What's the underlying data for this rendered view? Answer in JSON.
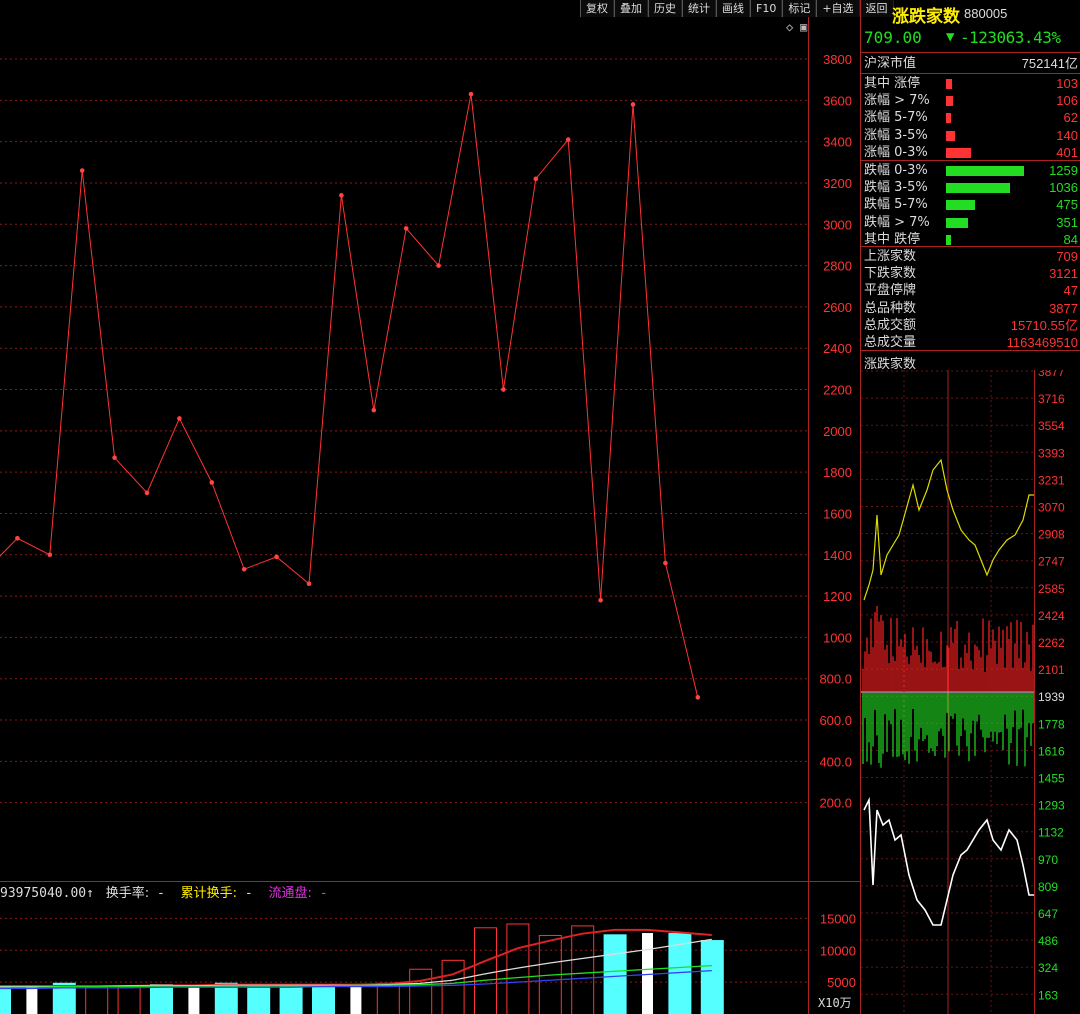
{
  "toolbar": [
    "复权",
    "叠加",
    "历史",
    "统计",
    "画线",
    "F10",
    "标记",
    "+自选",
    "返回"
  ],
  "header": {
    "name": "涨跌家数",
    "code": "880005",
    "price": "709.00",
    "change": "-123063.43%"
  },
  "market": {
    "label": "沪深市值",
    "value": "752141亿"
  },
  "stats_up": [
    {
      "label": "其中 涨停",
      "value": "103",
      "bar": 103
    },
    {
      "label": "涨幅 > 7%",
      "value": "106",
      "bar": 106
    },
    {
      "label": "涨幅 5-7%",
      "value": "62",
      "bar": 62
    },
    {
      "label": "涨幅 3-5%",
      "value": "140",
      "bar": 140
    },
    {
      "label": "涨幅 0-3%",
      "value": "401",
      "bar": 401
    }
  ],
  "stats_down": [
    {
      "label": "跌幅 0-3%",
      "value": "1259",
      "bar": 1259
    },
    {
      "label": "跌幅 3-5%",
      "value": "1036",
      "bar": 1036
    },
    {
      "label": "跌幅 5-7%",
      "value": "475",
      "bar": 475
    },
    {
      "label": "跌幅 > 7%",
      "value": "351",
      "bar": 351
    },
    {
      "label": "其中 跌停",
      "value": "84",
      "bar": 84
    }
  ],
  "summary": [
    {
      "label": "上涨家数",
      "value": "709"
    },
    {
      "label": "下跌家数",
      "value": "3121"
    },
    {
      "label": "平盘停牌",
      "value": "47"
    },
    {
      "label": "总品种数",
      "value": "3877"
    },
    {
      "label": "总成交额",
      "value": "15710.55亿"
    },
    {
      "label": "总成交量",
      "value": "1163469510"
    }
  ],
  "mini_title": "涨跌家数",
  "mini_axis": [
    "3877",
    "3716",
    "3554",
    "3393",
    "3231",
    "3070",
    "2908",
    "2747",
    "2585",
    "2424",
    "2262",
    "2101",
    "1939",
    "1778",
    "1616",
    "1455",
    "1293",
    "1132",
    "970",
    "809",
    "647",
    "486",
    "324",
    "163"
  ],
  "volume_panel": {
    "volume_text": "93975040.00↑",
    "turnover_label": "换手率:",
    "turnover_value": "-",
    "cum_turnover_label": "累计换手:",
    "cum_turnover_value": "-",
    "float_label": "流通盘:",
    "float_value": "-",
    "unit": "X10万",
    "ticks": [
      "15000",
      "10000",
      "5000"
    ]
  },
  "chart_data": {
    "type": "line",
    "y_ticks": [
      "3800",
      "3600",
      "3400",
      "3200",
      "3000",
      "2800",
      "2600",
      "2400",
      "2200",
      "2000",
      "1800",
      "1600",
      "1400",
      "1200",
      "1000",
      "800.0",
      "600.0",
      "400.0",
      "200.0"
    ],
    "ylim": [
      0,
      3900
    ],
    "series": [
      {
        "values": [
          1320,
          1480,
          1400,
          3260,
          1870,
          1700,
          2060,
          1750,
          1330,
          1390,
          1260,
          3140,
          2100,
          2980,
          2800,
          3630,
          2200,
          3220,
          3410,
          1180,
          3580,
          1360,
          710
        ]
      }
    ],
    "volume": {
      "ylim": [
        0,
        17000
      ],
      "bars": [
        {
          "v": 4300,
          "c": "cyan"
        },
        {
          "v": 4300,
          "c": "white"
        },
        {
          "v": 4900,
          "c": "cyan"
        },
        {
          "v": 4300,
          "c": "red"
        },
        {
          "v": 4300,
          "c": "red"
        },
        {
          "v": 4700,
          "c": "cyan"
        },
        {
          "v": 4500,
          "c": "white"
        },
        {
          "v": 4900,
          "c": "cyan"
        },
        {
          "v": 4300,
          "c": "cyan"
        },
        {
          "v": 4300,
          "c": "cyan"
        },
        {
          "v": 4300,
          "c": "cyan"
        },
        {
          "v": 4300,
          "c": "white"
        },
        {
          "v": 4900,
          "c": "red"
        },
        {
          "v": 7100,
          "c": "red"
        },
        {
          "v": 8500,
          "c": "red"
        },
        {
          "v": 13600,
          "c": "red"
        },
        {
          "v": 14200,
          "c": "red"
        },
        {
          "v": 12400,
          "c": "red"
        },
        {
          "v": 13900,
          "c": "red"
        },
        {
          "v": 12500,
          "c": "cyan"
        },
        {
          "v": 12700,
          "c": "white"
        },
        {
          "v": 12700,
          "c": "cyan"
        },
        {
          "v": 11600,
          "c": "cyan"
        }
      ],
      "ma": [
        {
          "color": "#dd2222",
          "values": [
            4400,
            4400,
            4400,
            4400,
            4400,
            4500,
            4500,
            4600,
            4600,
            4600,
            4600,
            4600,
            4700,
            5200,
            6200,
            8300,
            10300,
            11500,
            12600,
            13200,
            13200,
            12800,
            12400
          ]
        },
        {
          "color": "#dddddd",
          "values": [
            4300,
            4300,
            4300,
            4300,
            4400,
            4400,
            4400,
            4500,
            4500,
            4500,
            4500,
            4500,
            4600,
            4800,
            5300,
            6300,
            7200,
            8000,
            8700,
            9400,
            10100,
            10900,
            11700
          ]
        },
        {
          "color": "#22dd22",
          "values": [
            4200,
            4200,
            4300,
            4300,
            4300,
            4300,
            4300,
            4400,
            4400,
            4400,
            4400,
            4500,
            4500,
            4600,
            4800,
            5300,
            5700,
            6100,
            6400,
            6700,
            7000,
            7300,
            7600
          ]
        },
        {
          "color": "#3344ee",
          "values": [
            4000,
            4000,
            4100,
            4100,
            4100,
            4200,
            4200,
            4200,
            4200,
            4200,
            4300,
            4300,
            4300,
            4400,
            4500,
            4700,
            5000,
            5300,
            5600,
            5900,
            6200,
            6500,
            6800
          ]
        }
      ]
    }
  }
}
